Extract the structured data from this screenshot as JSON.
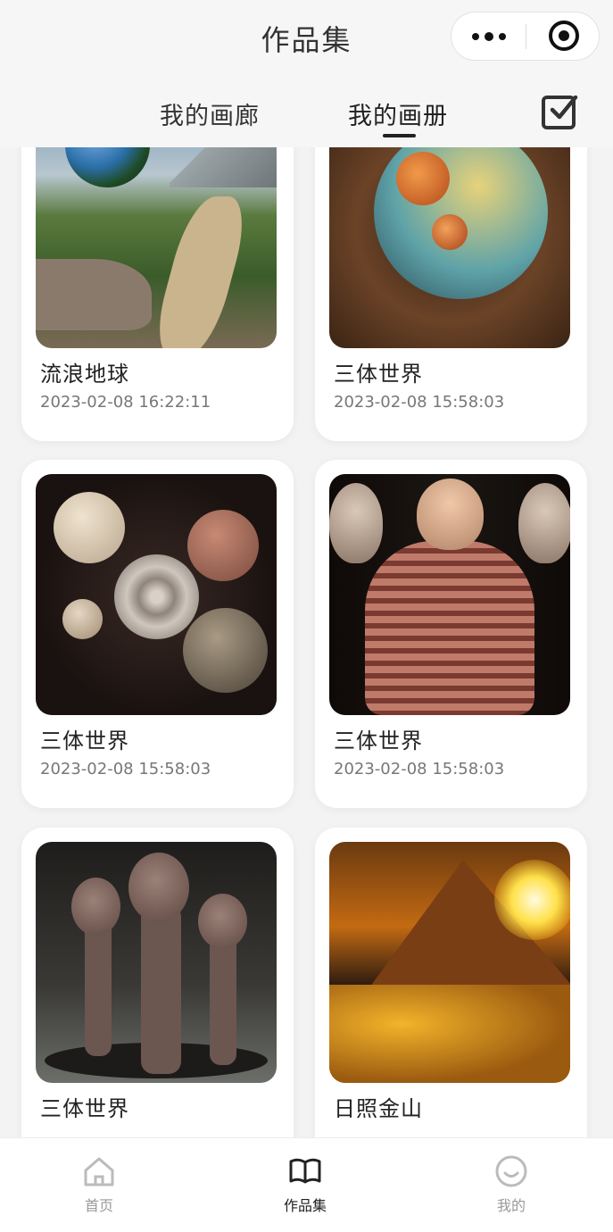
{
  "header": {
    "title": "作品集",
    "tabs": [
      {
        "label": "我的画廊",
        "active": false
      },
      {
        "label": "我的画册",
        "active": true
      }
    ]
  },
  "gallery": {
    "items": [
      {
        "name": "流浪地球",
        "date": "2023-02-08 16:22:11"
      },
      {
        "name": "三体世界",
        "date": "2023-02-08 15:58:03"
      },
      {
        "name": "三体世界",
        "date": "2023-02-08 15:58:03"
      },
      {
        "name": "三体世界",
        "date": "2023-02-08 15:58:03"
      },
      {
        "name": "三体世界",
        "date": ""
      },
      {
        "name": "日照金山",
        "date": ""
      }
    ]
  },
  "tabbar": {
    "items": [
      {
        "label": "首页",
        "icon": "home-icon",
        "active": false
      },
      {
        "label": "作品集",
        "icon": "book-icon",
        "active": true
      },
      {
        "label": "我的",
        "icon": "profile-icon",
        "active": false
      }
    ]
  },
  "colors": {
    "background": "#f3f3f3",
    "card": "#ffffff",
    "text_primary": "#222222",
    "text_secondary": "#777777",
    "tab_inactive": "#999999"
  }
}
